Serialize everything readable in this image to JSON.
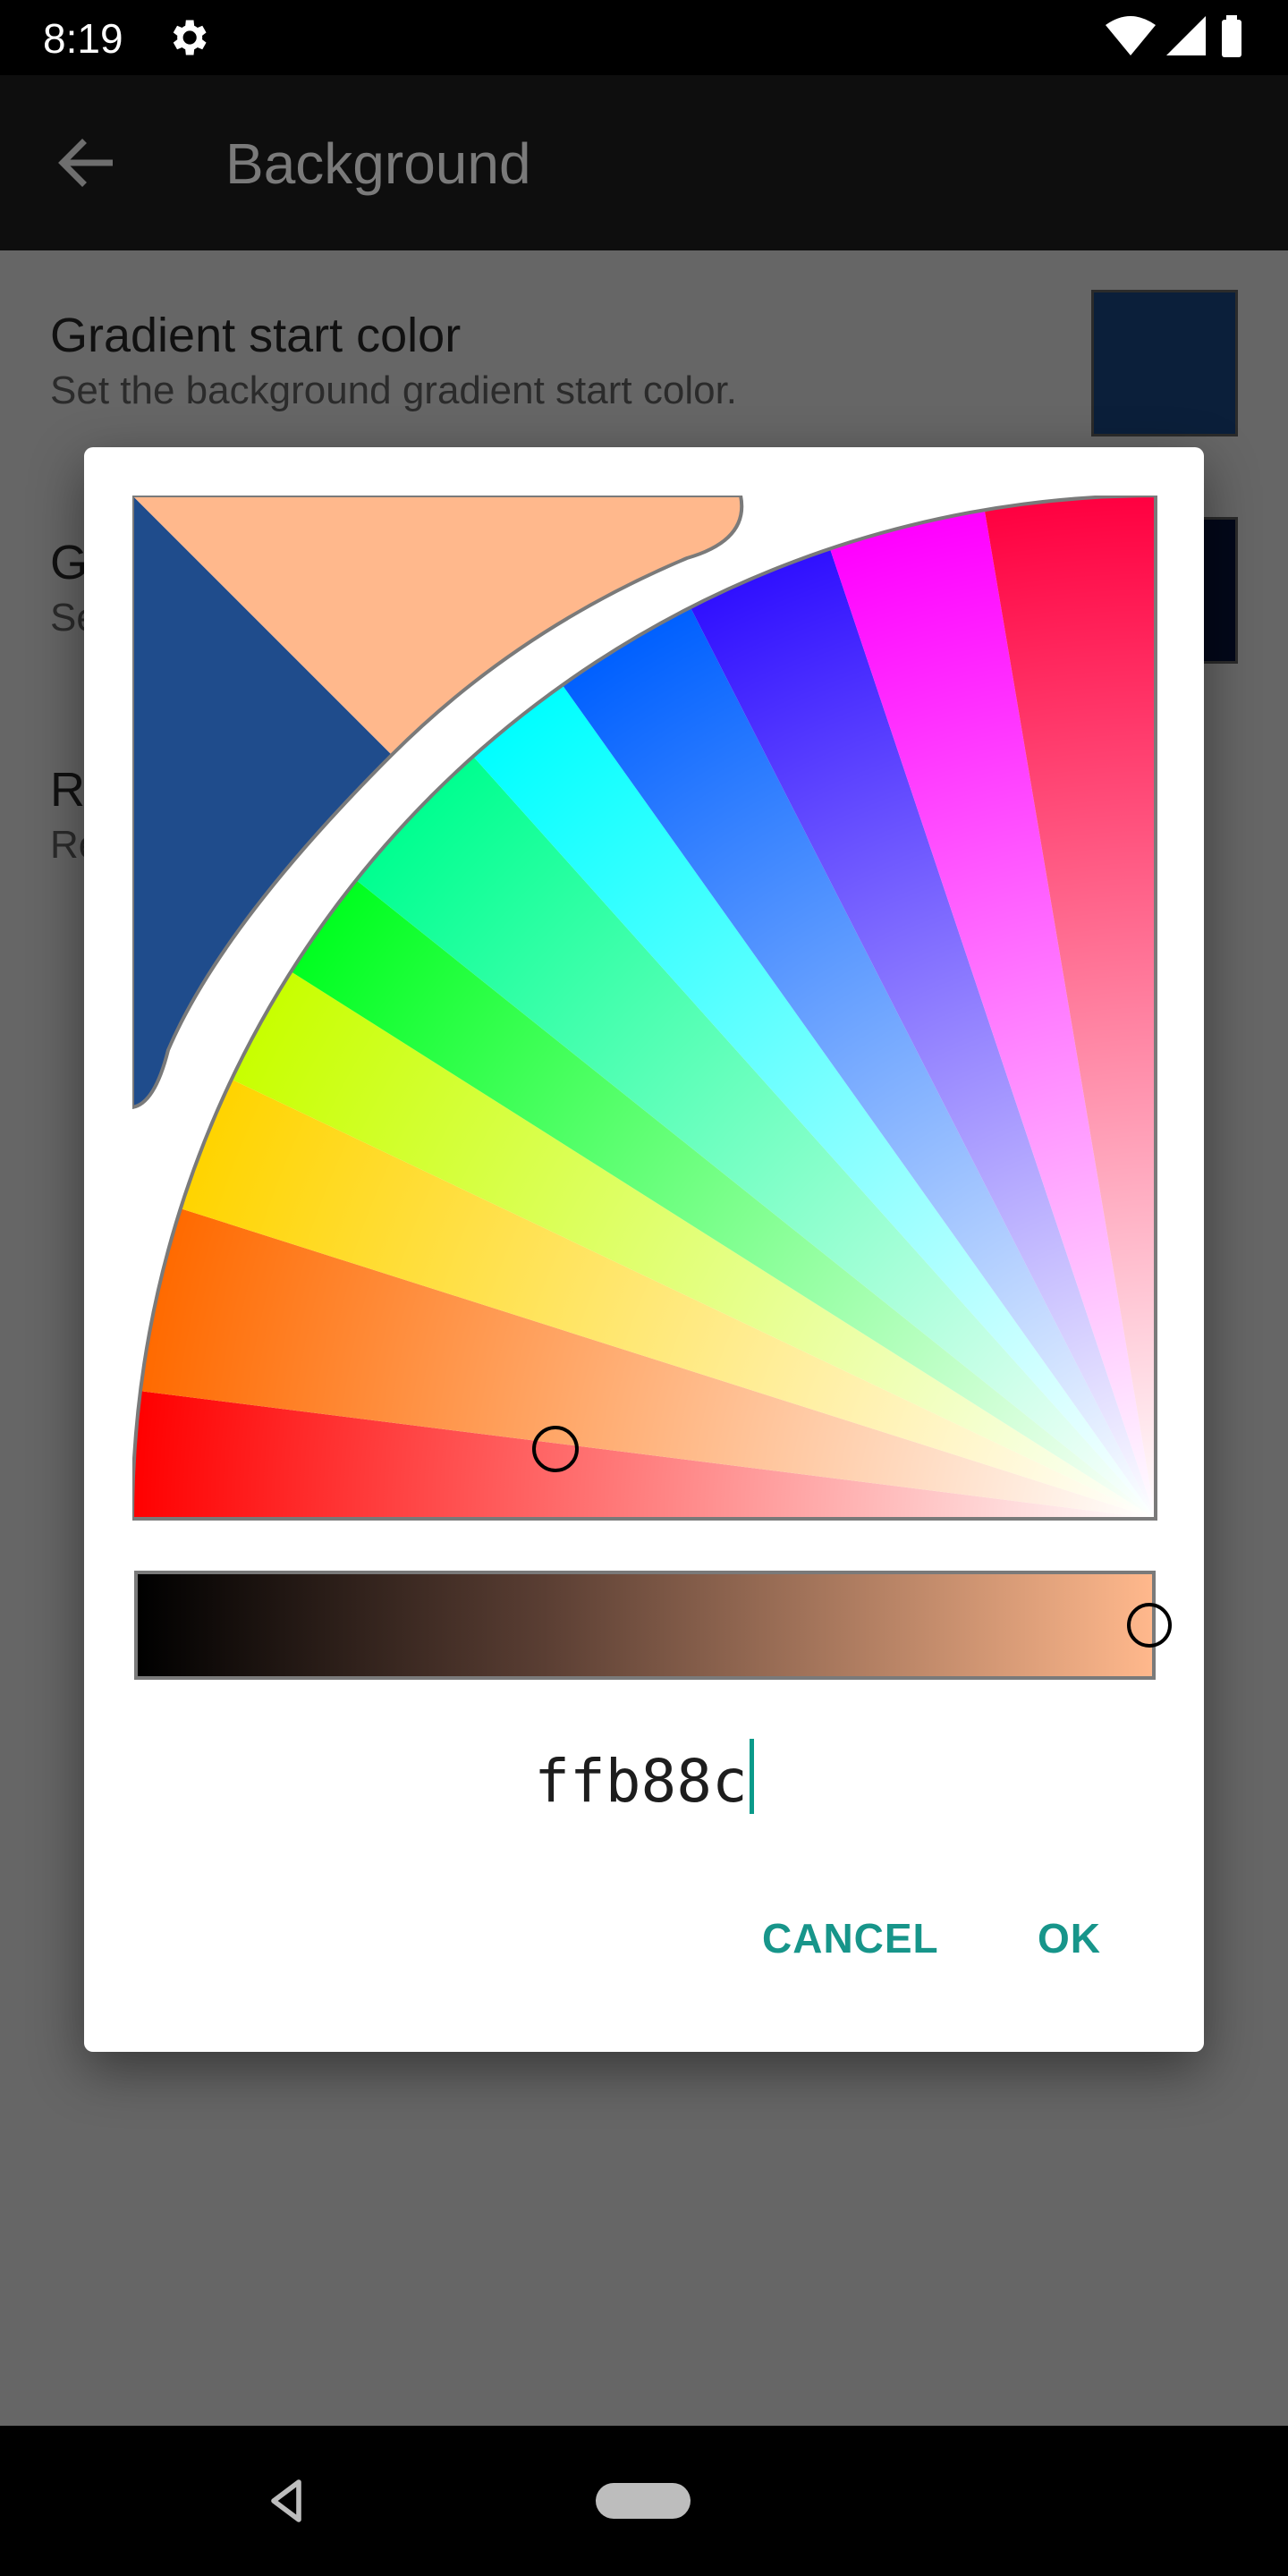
{
  "status_bar": {
    "time": "8:19"
  },
  "app_bar": {
    "title": "Background"
  },
  "list": {
    "items": [
      {
        "title": "Gradient start color",
        "subtitle": "Set the background gradient start color.",
        "swatch_color": "#0b1f3a"
      },
      {
        "title": "G",
        "subtitle": "Se",
        "swatch_color": "#03081a"
      },
      {
        "title": "R",
        "subtitle": "Re"
      }
    ]
  },
  "dialog": {
    "old_color": "#1f4c8c",
    "new_color": "#ffb88c",
    "hex_value": "ffb88c",
    "cancel_label": "CANCEL",
    "ok_label": "OK",
    "brightness_level": 1.0
  },
  "colors": {
    "accent": "#17958a",
    "scrim": "#666666"
  }
}
